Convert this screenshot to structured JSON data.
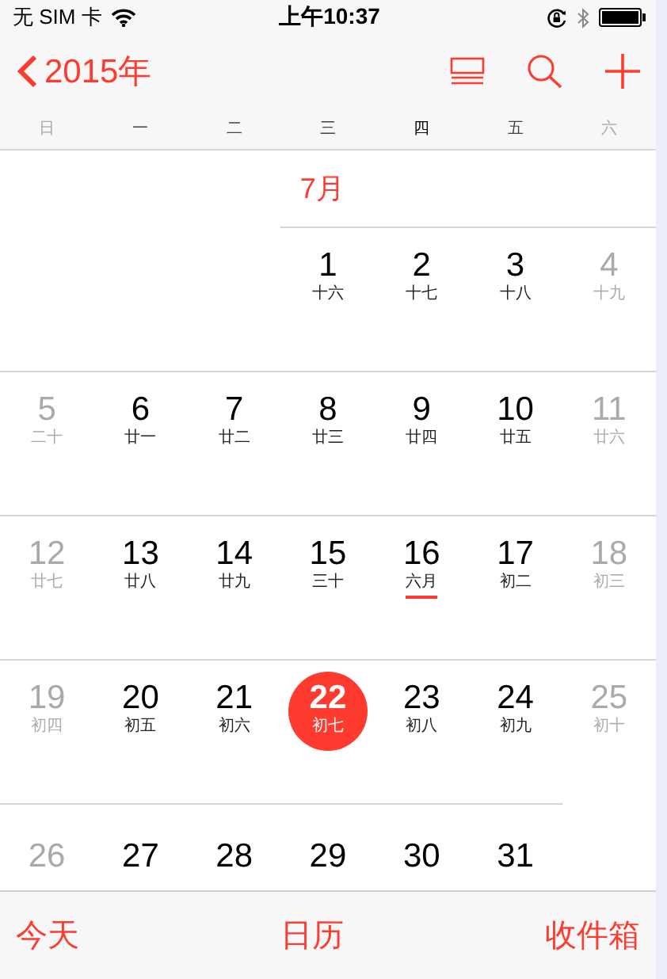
{
  "status_bar": {
    "carrier": "无 SIM 卡",
    "time": "上午10:37"
  },
  "nav": {
    "back_label": "2015年"
  },
  "weekdays": [
    {
      "label": "日",
      "muted": true,
      "highlighted": false
    },
    {
      "label": "一",
      "muted": false,
      "highlighted": false
    },
    {
      "label": "二",
      "muted": false,
      "highlighted": false
    },
    {
      "label": "三",
      "muted": false,
      "highlighted": false
    },
    {
      "label": "四",
      "muted": false,
      "highlighted": true
    },
    {
      "label": "五",
      "muted": false,
      "highlighted": false
    },
    {
      "label": "六",
      "muted": true,
      "highlighted": false
    }
  ],
  "month_label": "7月",
  "weeks": [
    [
      {
        "kind": "blank"
      },
      {
        "kind": "blank"
      },
      {
        "kind": "blank"
      },
      {
        "kind": "day",
        "day": "1",
        "lunar": "十六",
        "muted": false,
        "selected": false,
        "underlined": false
      },
      {
        "kind": "day",
        "day": "2",
        "lunar": "十七",
        "muted": false,
        "selected": false,
        "underlined": false
      },
      {
        "kind": "day",
        "day": "3",
        "lunar": "十八",
        "muted": false,
        "selected": false,
        "underlined": false
      },
      {
        "kind": "day",
        "day": "4",
        "lunar": "十九",
        "muted": true,
        "selected": false,
        "underlined": false
      }
    ],
    [
      {
        "kind": "day",
        "day": "5",
        "lunar": "二十",
        "muted": true,
        "selected": false,
        "underlined": false
      },
      {
        "kind": "day",
        "day": "6",
        "lunar": "廿一",
        "muted": false,
        "selected": false,
        "underlined": false
      },
      {
        "kind": "day",
        "day": "7",
        "lunar": "廿二",
        "muted": false,
        "selected": false,
        "underlined": false
      },
      {
        "kind": "day",
        "day": "8",
        "lunar": "廿三",
        "muted": false,
        "selected": false,
        "underlined": false
      },
      {
        "kind": "day",
        "day": "9",
        "lunar": "廿四",
        "muted": false,
        "selected": false,
        "underlined": false
      },
      {
        "kind": "day",
        "day": "10",
        "lunar": "廿五",
        "muted": false,
        "selected": false,
        "underlined": false
      },
      {
        "kind": "day",
        "day": "11",
        "lunar": "廿六",
        "muted": true,
        "selected": false,
        "underlined": false
      }
    ],
    [
      {
        "kind": "day",
        "day": "12",
        "lunar": "廿七",
        "muted": true,
        "selected": false,
        "underlined": false
      },
      {
        "kind": "day",
        "day": "13",
        "lunar": "廿八",
        "muted": false,
        "selected": false,
        "underlined": false
      },
      {
        "kind": "day",
        "day": "14",
        "lunar": "廿九",
        "muted": false,
        "selected": false,
        "underlined": false
      },
      {
        "kind": "day",
        "day": "15",
        "lunar": "三十",
        "muted": false,
        "selected": false,
        "underlined": false
      },
      {
        "kind": "day",
        "day": "16",
        "lunar": "六月",
        "muted": false,
        "selected": false,
        "underlined": true
      },
      {
        "kind": "day",
        "day": "17",
        "lunar": "初二",
        "muted": false,
        "selected": false,
        "underlined": false
      },
      {
        "kind": "day",
        "day": "18",
        "lunar": "初三",
        "muted": true,
        "selected": false,
        "underlined": false
      }
    ],
    [
      {
        "kind": "day",
        "day": "19",
        "lunar": "初四",
        "muted": true,
        "selected": false,
        "underlined": false
      },
      {
        "kind": "day",
        "day": "20",
        "lunar": "初五",
        "muted": false,
        "selected": false,
        "underlined": false
      },
      {
        "kind": "day",
        "day": "21",
        "lunar": "初六",
        "muted": false,
        "selected": false,
        "underlined": false
      },
      {
        "kind": "day",
        "day": "22",
        "lunar": "初七",
        "selected": true,
        "underlined": false
      },
      {
        "kind": "day",
        "day": "23",
        "lunar": "初八",
        "muted": false,
        "selected": false,
        "underlined": false
      },
      {
        "kind": "day",
        "day": "24",
        "lunar": "初九",
        "muted": false,
        "selected": false,
        "underlined": false
      },
      {
        "kind": "day",
        "day": "25",
        "lunar": "初十",
        "muted": true,
        "selected": false,
        "underlined": false
      }
    ],
    [
      {
        "kind": "day",
        "day": "26",
        "muted": true,
        "selected": false
      },
      {
        "kind": "day",
        "day": "27",
        "muted": false,
        "selected": false
      },
      {
        "kind": "day",
        "day": "28",
        "muted": false,
        "selected": false
      },
      {
        "kind": "day",
        "day": "29",
        "muted": false,
        "selected": false
      },
      {
        "kind": "day",
        "day": "30",
        "muted": false,
        "selected": false
      },
      {
        "kind": "day",
        "day": "31",
        "muted": false,
        "selected": false
      },
      {
        "kind": "blank"
      }
    ]
  ],
  "tab_bar": [
    "今天",
    "日历",
    "收件箱"
  ]
}
